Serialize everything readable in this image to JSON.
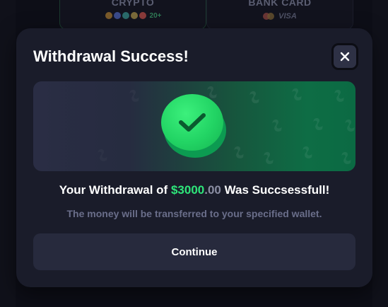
{
  "background": {
    "cards": [
      {
        "label": "CRYPTO",
        "count": "20+"
      },
      {
        "label": "BANK CARD",
        "brand": "VISA"
      }
    ],
    "coin_colors": [
      "#7a5a2a",
      "#3a4a8a",
      "#2a6a6a",
      "#7a6a3a",
      "#8a3a3a"
    ]
  },
  "modal": {
    "title": "Withdrawal Success!",
    "close_icon": "close-icon",
    "message": {
      "prefix": "Your Withdrawal of ",
      "amount_main": "$3000",
      "amount_cents": ".00",
      "suffix": " Was Succsessfull!"
    },
    "subtext": "The money will be transferred to your specified wallet.",
    "continue_label": "Continue",
    "success_icon": "checkmark-icon"
  },
  "colors": {
    "accent_green": "#2ee57a",
    "modal_bg": "#1a1c2a",
    "button_bg": "#272a3d"
  }
}
